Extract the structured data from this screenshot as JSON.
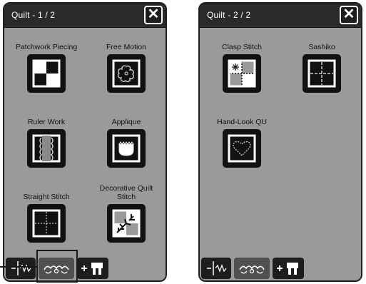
{
  "panel1": {
    "title": "Quilt - 1 / 2",
    "close_label": "✕",
    "items": [
      {
        "label": "Patchwork Piecing",
        "icon": "patchwork-piecing-icon"
      },
      {
        "label": "Free Motion",
        "icon": "free-motion-icon"
      },
      {
        "label": "Ruler Work",
        "icon": "ruler-work-icon"
      },
      {
        "label": "Applique",
        "icon": "applique-icon"
      },
      {
        "label": "Straight Stitch",
        "icon": "straight-stitch-icon"
      },
      {
        "label": "Decorative Quilt Stitch",
        "icon": "decorative-quilt-stitch-icon"
      }
    ]
  },
  "panel2": {
    "title": "Quilt - 2 / 2",
    "close_label": "✕",
    "items": [
      {
        "label": "Clasp Stitch",
        "icon": "clasp-stitch-icon"
      },
      {
        "label": "Sashiko",
        "icon": "sashiko-icon"
      },
      {
        "label": "Hand-Look QU",
        "icon": "hand-look-quilt-icon"
      }
    ]
  },
  "bottom_tabs": [
    {
      "icon": "utility-stitch-icon",
      "selected": false
    },
    {
      "icon": "decorative-stitch-icon",
      "selected": true
    },
    {
      "icon": "add-presser-foot-icon",
      "selected": false
    }
  ]
}
